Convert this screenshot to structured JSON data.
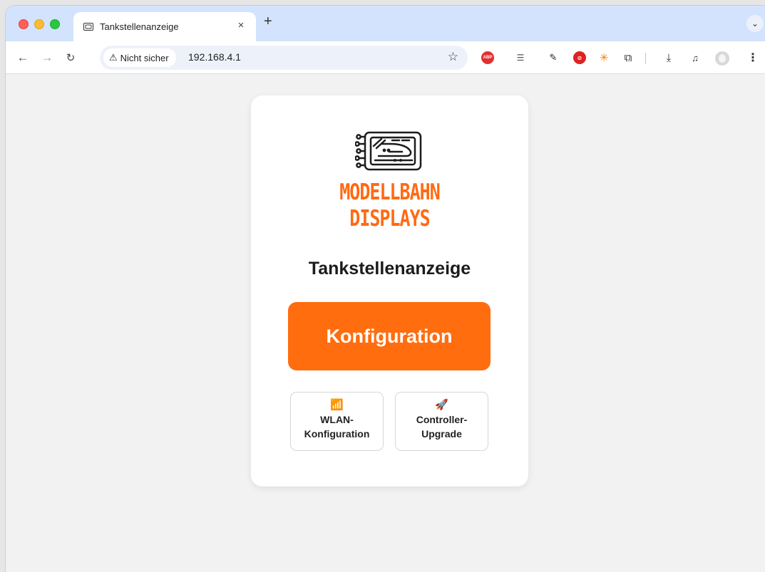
{
  "browser": {
    "tab_title": "Tankstellenanzeige",
    "tab_close": "×",
    "new_tab": "+",
    "tab_menu": "⌄",
    "security_label": "Nicht sicher",
    "security_icon": "⚠",
    "url": "192.168.4.1",
    "bookmark_icon": "☆",
    "menu_icon": "⋮",
    "extensions": {
      "adblock_label": "ABP"
    }
  },
  "page": {
    "logo": {
      "line1": "MODELLBAHN",
      "line2": "DISPLAYS",
      "color": "#ff6a13"
    },
    "title": "Tankstellenanzeige",
    "primary_button": "Konfiguration",
    "accent_color": "#ff6d0e",
    "wlan_button": {
      "icon": "📶",
      "line1": "WLAN-",
      "line2": "Konfiguration"
    },
    "upgrade_button": {
      "icon": "🚀",
      "line1": "Controller-",
      "line2": "Upgrade"
    }
  }
}
